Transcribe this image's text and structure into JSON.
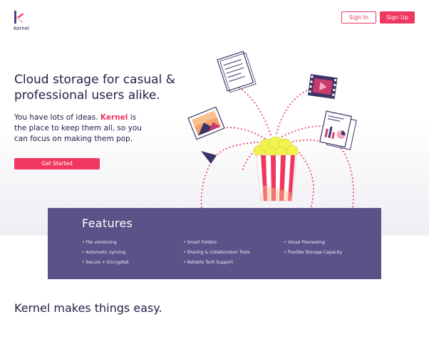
{
  "brand": {
    "name": "Kernel"
  },
  "header": {
    "sign_in": "Sign In",
    "sign_up": "Sign Up"
  },
  "hero": {
    "title": "Cloud storage for casual & professional users alike.",
    "text_before": "You have lots of ideas.",
    "text_brand": "Kernel",
    "text_after": "is the place to keep them all, so you can focus on making them pop.",
    "cta": "Get Started"
  },
  "features": {
    "title": "Features",
    "columns": [
      [
        "File versioning",
        "Automatic syncing",
        "Secure + Encrypted"
      ],
      [
        "Smart Folders",
        "Sharing & Collaboration Tools",
        "Reliable Tech Support"
      ],
      [
        "Visual Previewing",
        "Flexible Storage Capacity"
      ]
    ]
  },
  "section2": {
    "title": "Kernel makes things easy."
  },
  "colors": {
    "accent": "#f0375f",
    "purple": "#5a5288",
    "navy": "#23204a"
  },
  "illustration": {
    "icons": [
      "document-icon",
      "video-file-icon",
      "photo-icon",
      "report-icon",
      "popcorn-icon"
    ]
  }
}
